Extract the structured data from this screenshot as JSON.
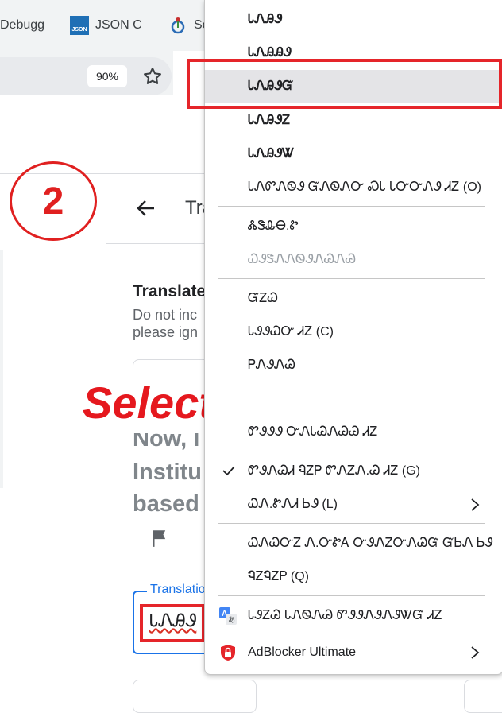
{
  "browser": {
    "bookmarks": [
      {
        "label": "Debugg",
        "icon": "globe-icon"
      },
      {
        "label": "JSON C",
        "icon": "json-icon",
        "icon_text": "JSON"
      },
      {
        "label": "Se",
        "icon": "wikimedia-icon"
      }
    ],
    "zoom_level": "90%"
  },
  "annotations": {
    "step_number": "2",
    "callout_text": "Select right"
  },
  "panel": {
    "title_fragment": "Tra",
    "section_heading": "Translate",
    "description_line1": "Do not inc",
    "description_line2": "please ign",
    "source_text_lines": [
      "Now, I",
      "Institu",
      "based"
    ],
    "right_clip_chars": [
      "t",
      "e",
      "c"
    ],
    "translation_label": "Translatio",
    "translation_value": "ᏓᏁᎯᏭ"
  },
  "context_menu": {
    "items": [
      {
        "label": "ᏓᏁᎯᏭ",
        "style": "bold"
      },
      {
        "label": "ᏓᏁᎯᎯᏭ",
        "style": "bold"
      },
      {
        "label": "ᏓᏁᎯᏭᏳ",
        "style": "bold",
        "highlighted": true
      },
      {
        "label": "ᏓᏁᎯᏭᏃ",
        "style": "bold"
      },
      {
        "label": "ᏓᏁᎯᏭᏔ",
        "style": "bold"
      },
      {
        "label": "ᏓᏁᏛᏁᏫᏭ ᏳᏁᏫᏁᏅ ᏍᏓ ᏓᏅᏅᏁᏭ ᏗᏃ (O)"
      },
      {
        "label": "ᏜᏕᎲᎾ.Ꮡ",
        "separator_before": true
      },
      {
        "label": "ᏇᏭᏕᏁᏁᏫᏭᏁᏊᏁᏊ",
        "style": "disabled"
      },
      {
        "label": "ᏳᏃᏇ",
        "separator_before": true
      },
      {
        "label": "ᏓᏭᏭᏇᏅ ᏗᏃ (C)"
      },
      {
        "label": "ᏢᏁᏭᏁᏊ"
      },
      {
        "label": "ᏛᏭᏭᏭ ᏅᏁᏓᏊᏁᏊᏊ ᏗᏃ"
      },
      {
        "label": "ᏛᏭᏁᏊᏗ ᏄᏃᏢ ᏛᏁᏃᏁ.Ꮚ ᏗᏃ (G)",
        "checked": true,
        "separator_before": true
      },
      {
        "label": "ᏇᏁ.ᏑᏁᏗ ᏏᏭ (L)",
        "submenu": true
      },
      {
        "label": "ᏇᏁᏇᏅᏃ Ꮑ.ᏅᏑᎪ ᏅᏭᏁᏃᏅᏁᏊᏳ ᏳᏏᏁ ᏏᏭ",
        "separator_before": true
      },
      {
        "label": "ᏄᏃᏄᏃᏢ (Q)"
      },
      {
        "label": "ᏓᏭᏃᏊ ᏓᏁᏫᏁᏊ ᏛᏭᏭᏁᏭᏁᏭᏔᏳ ᏗᏃ",
        "icon": "translate-icon",
        "separator_before": true
      },
      {
        "label": "AdBlocker Ultimate",
        "icon": "adblock-shield-icon",
        "submenu": true
      }
    ]
  },
  "colors": {
    "annotation_red": "#e5252a",
    "accent_blue": "#1a73e8",
    "menu_highlight": "#e4e4e7"
  }
}
